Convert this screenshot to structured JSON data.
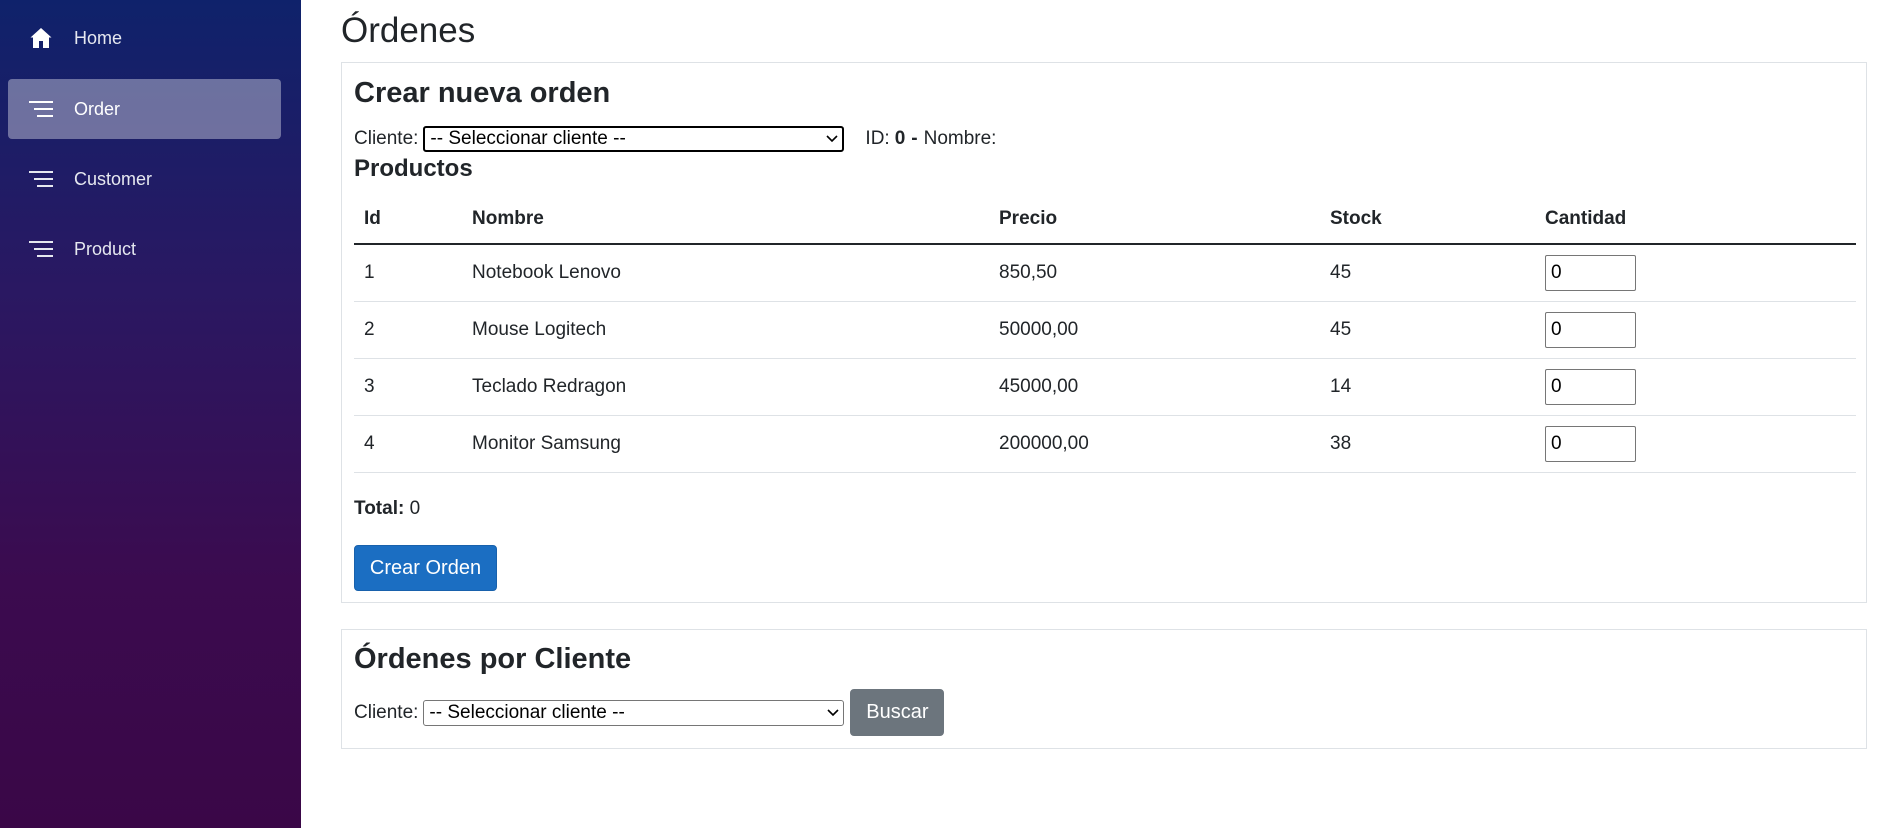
{
  "sidebar": {
    "items": [
      {
        "label": "Home",
        "icon": "home-icon",
        "active": false
      },
      {
        "label": "Order",
        "icon": "list-icon",
        "active": true
      },
      {
        "label": "Customer",
        "icon": "list-icon",
        "active": false
      },
      {
        "label": "Product",
        "icon": "list-icon",
        "active": false
      }
    ]
  },
  "page": {
    "title": "Órdenes"
  },
  "create_order": {
    "title": "Crear nueva orden",
    "client_label": "Cliente:",
    "client_select_value": "-- Seleccionar cliente --",
    "id_label": "ID:",
    "id_value": "0",
    "separator": "-",
    "name_label": "Nombre:",
    "products_title": "Productos",
    "columns": [
      "Id",
      "Nombre",
      "Precio",
      "Stock",
      "Cantidad"
    ],
    "rows": [
      {
        "id": "1",
        "name": "Notebook Lenovo",
        "price": "850,50",
        "stock": "45",
        "qty": "0"
      },
      {
        "id": "2",
        "name": "Mouse Logitech",
        "price": "50000,00",
        "stock": "45",
        "qty": "0"
      },
      {
        "id": "3",
        "name": "Teclado Redragon",
        "price": "45000,00",
        "stock": "14",
        "qty": "0"
      },
      {
        "id": "4",
        "name": "Monitor Samsung",
        "price": "200000,00",
        "stock": "38",
        "qty": "0"
      }
    ],
    "total_label": "Total:",
    "total_value": "0",
    "submit_label": "Crear Orden"
  },
  "orders_by_client": {
    "title": "Órdenes por Cliente",
    "client_label": "Cliente:",
    "client_select_value": "-- Seleccionar cliente --",
    "search_label": "Buscar"
  },
  "colors": {
    "primary": "#1b6ec2",
    "secondary": "#6c757d",
    "sidebar_top": "#0f226b",
    "sidebar_bottom": "#3a0747"
  }
}
